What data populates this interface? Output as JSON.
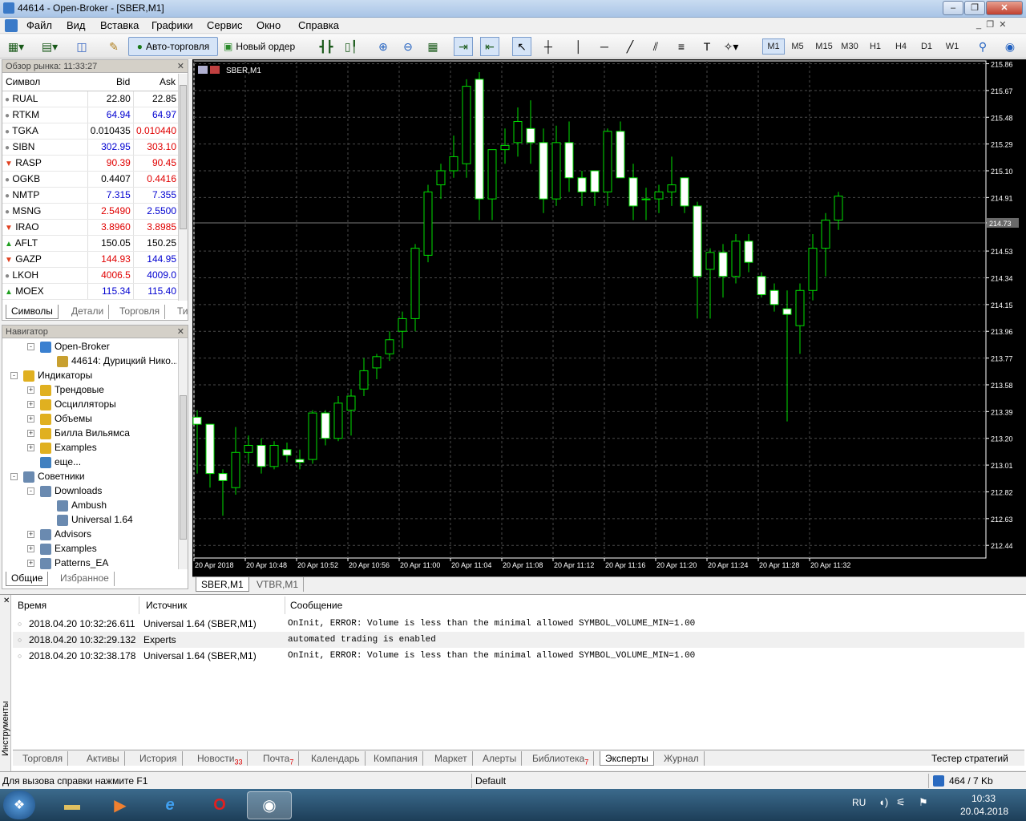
{
  "window": {
    "title": "44614 - Open-Broker - [SBER,M1]"
  },
  "menu": [
    "Файл",
    "Вид",
    "Вставка",
    "Графики",
    "Сервис",
    "Окно",
    "Справка"
  ],
  "toolbar": {
    "autotrade_label": "Авто-торговля",
    "new_order_label": "Новый ордер",
    "timeframes": [
      "M1",
      "M5",
      "M15",
      "M30",
      "H1",
      "H4",
      "D1",
      "W1"
    ],
    "active_timeframe": "M1"
  },
  "market_watch": {
    "header": "Обзор рынка: 11:33:27",
    "columns": [
      "Символ",
      "Bid",
      "Ask"
    ],
    "rows": [
      {
        "symbol": "RUAL",
        "bid": "22.80",
        "ask": "22.85",
        "bid_color": "blk",
        "ask_color": "blk",
        "icon": "grey"
      },
      {
        "symbol": "RTKM",
        "bid": "64.94",
        "ask": "64.97",
        "bid_color": "blue",
        "ask_color": "blue",
        "icon": "grey"
      },
      {
        "symbol": "TGKA",
        "bid": "0.010435",
        "ask": "0.010440",
        "bid_color": "blk",
        "ask_color": "red",
        "icon": "grey"
      },
      {
        "symbol": "SIBN",
        "bid": "302.95",
        "ask": "303.10",
        "bid_color": "blue",
        "ask_color": "red",
        "icon": "grey"
      },
      {
        "symbol": "RASP",
        "bid": "90.39",
        "ask": "90.45",
        "bid_color": "red",
        "ask_color": "red",
        "icon": "down"
      },
      {
        "symbol": "OGKB",
        "bid": "0.4407",
        "ask": "0.4416",
        "bid_color": "blk",
        "ask_color": "red",
        "icon": "grey"
      },
      {
        "symbol": "NMTP",
        "bid": "7.315",
        "ask": "7.355",
        "bid_color": "blue",
        "ask_color": "blue",
        "icon": "grey"
      },
      {
        "symbol": "MSNG",
        "bid": "2.5490",
        "ask": "2.5500",
        "bid_color": "red",
        "ask_color": "blue",
        "icon": "grey"
      },
      {
        "symbol": "IRAO",
        "bid": "3.8960",
        "ask": "3.8985",
        "bid_color": "red",
        "ask_color": "red",
        "icon": "down"
      },
      {
        "symbol": "AFLT",
        "bid": "150.05",
        "ask": "150.25",
        "bid_color": "blk",
        "ask_color": "blk",
        "icon": "up"
      },
      {
        "symbol": "GAZP",
        "bid": "144.93",
        "ask": "144.95",
        "bid_color": "red",
        "ask_color": "blue",
        "icon": "down"
      },
      {
        "symbol": "LKOH",
        "bid": "4006.5",
        "ask": "4009.0",
        "bid_color": "red",
        "ask_color": "blue",
        "icon": "grey"
      },
      {
        "symbol": "MOEX",
        "bid": "115.34",
        "ask": "115.40",
        "bid_color": "blue",
        "ask_color": "blue",
        "icon": "up"
      }
    ],
    "tabs": [
      "Символы",
      "Детали",
      "Торговля",
      "Ти"
    ]
  },
  "navigator": {
    "header": "Навигатор",
    "items": [
      {
        "label": "Open-Broker",
        "level": 2,
        "exp": "-",
        "icon": "broker"
      },
      {
        "label": "44614: Дурицкий Нико...",
        "level": 3,
        "exp": "",
        "icon": "account"
      },
      {
        "label": "Индикаторы",
        "level": 1,
        "exp": "-",
        "icon": "f"
      },
      {
        "label": "Трендовые",
        "level": 2,
        "exp": "+",
        "icon": "f"
      },
      {
        "label": "Осцилляторы",
        "level": 2,
        "exp": "+",
        "icon": "f"
      },
      {
        "label": "Объемы",
        "level": 2,
        "exp": "+",
        "icon": "f"
      },
      {
        "label": "Билла Вильямса",
        "level": 2,
        "exp": "+",
        "icon": "f"
      },
      {
        "label": "Examples",
        "level": 2,
        "exp": "+",
        "icon": "f"
      },
      {
        "label": "еще...",
        "level": 2,
        "exp": "",
        "icon": "more"
      },
      {
        "label": "Советники",
        "level": 1,
        "exp": "-",
        "icon": "ea"
      },
      {
        "label": "Downloads",
        "level": 2,
        "exp": "-",
        "icon": "ea"
      },
      {
        "label": "Ambush",
        "level": 3,
        "exp": "",
        "icon": "ea"
      },
      {
        "label": "Universal 1.64",
        "level": 3,
        "exp": "",
        "icon": "ea"
      },
      {
        "label": "Advisors",
        "level": 2,
        "exp": "+",
        "icon": "ea"
      },
      {
        "label": "Examples",
        "level": 2,
        "exp": "+",
        "icon": "ea"
      },
      {
        "label": "Patterns_EA",
        "level": 2,
        "exp": "+",
        "icon": "ea"
      }
    ],
    "tabs": [
      "Общие",
      "Избранное"
    ]
  },
  "chart_data": {
    "type": "candlestick",
    "title": "SBER,M1",
    "current_price": "214.73",
    "y_ticks": [
      "215.86",
      "215.67",
      "215.48",
      "215.29",
      "215.10",
      "214.91",
      "214.73",
      "214.53",
      "214.34",
      "214.15",
      "213.96",
      "213.77",
      "213.58",
      "213.39",
      "213.20",
      "213.01",
      "212.82",
      "212.63",
      "212.44"
    ],
    "x_ticks": [
      "20 Apr 2018",
      "20 Apr 10:48",
      "20 Apr 10:52",
      "20 Apr 10:56",
      "20 Apr 11:00",
      "20 Apr 11:04",
      "20 Apr 11:08",
      "20 Apr 11:12",
      "20 Apr 11:16",
      "20 Apr 11:20",
      "20 Apr 11:24",
      "20 Apr 11:28",
      "20 Apr 11:32"
    ],
    "ylim": [
      212.35,
      215.88
    ],
    "candles": [
      [
        213.35,
        213.4,
        212.95,
        213.3
      ],
      [
        213.3,
        213.3,
        212.85,
        212.95
      ],
      [
        212.95,
        212.98,
        212.65,
        212.9
      ],
      [
        212.85,
        213.28,
        212.8,
        213.1
      ],
      [
        213.1,
        213.22,
        213.02,
        213.15
      ],
      [
        213.15,
        213.2,
        212.95,
        213.0
      ],
      [
        213.0,
        213.18,
        212.98,
        213.15
      ],
      [
        213.12,
        213.17,
        213.03,
        213.08
      ],
      [
        213.05,
        213.12,
        212.98,
        213.03
      ],
      [
        213.05,
        213.4,
        213.02,
        213.38
      ],
      [
        213.38,
        213.4,
        213.15,
        213.2
      ],
      [
        213.2,
        213.5,
        213.18,
        213.45
      ],
      [
        213.4,
        213.55,
        213.22,
        213.5
      ],
      [
        213.55,
        213.77,
        213.5,
        213.68
      ],
      [
        213.7,
        213.8,
        213.62,
        213.78
      ],
      [
        213.8,
        213.96,
        213.75,
        213.9
      ],
      [
        213.96,
        214.1,
        213.84,
        214.05
      ],
      [
        214.05,
        214.58,
        213.96,
        214.55
      ],
      [
        214.5,
        215.0,
        214.45,
        214.95
      ],
      [
        215.0,
        215.15,
        214.9,
        215.1
      ],
      [
        215.1,
        215.35,
        215.05,
        215.2
      ],
      [
        215.15,
        215.75,
        215.05,
        215.7
      ],
      [
        215.75,
        215.8,
        214.75,
        214.9
      ],
      [
        214.9,
        215.25,
        214.75,
        215.25
      ],
      [
        215.25,
        215.4,
        215.15,
        215.28
      ],
      [
        215.3,
        215.55,
        215.2,
        215.45
      ],
      [
        215.4,
        215.6,
        215.15,
        215.3
      ],
      [
        215.3,
        215.4,
        214.8,
        214.9
      ],
      [
        214.9,
        215.42,
        214.85,
        215.3
      ],
      [
        215.3,
        215.45,
        214.95,
        215.05
      ],
      [
        215.05,
        215.1,
        214.85,
        214.95
      ],
      [
        215.1,
        215.1,
        214.85,
        214.95
      ],
      [
        214.95,
        215.4,
        214.85,
        215.38
      ],
      [
        215.38,
        215.45,
        215.05,
        215.05
      ],
      [
        215.05,
        215.15,
        214.75,
        214.85
      ],
      [
        214.9,
        214.98,
        214.75,
        214.9
      ],
      [
        214.9,
        215.0,
        214.8,
        214.95
      ],
      [
        214.95,
        215.2,
        214.85,
        215.0
      ],
      [
        215.05,
        215.05,
        214.8,
        214.85
      ],
      [
        214.85,
        214.88,
        214.05,
        214.35
      ],
      [
        214.4,
        214.55,
        214.05,
        214.52
      ],
      [
        214.52,
        214.58,
        214.2,
        214.35
      ],
      [
        214.35,
        214.65,
        214.3,
        214.6
      ],
      [
        214.6,
        214.65,
        214.38,
        214.45
      ],
      [
        214.35,
        214.38,
        214.2,
        214.22
      ],
      [
        214.25,
        214.3,
        214.1,
        214.15
      ],
      [
        214.12,
        214.25,
        213.32,
        214.08
      ],
      [
        214.0,
        214.3,
        213.8,
        214.25
      ],
      [
        214.25,
        214.65,
        214.18,
        214.55
      ],
      [
        214.55,
        214.8,
        214.35,
        214.75
      ],
      [
        214.75,
        214.95,
        214.68,
        214.92
      ]
    ]
  },
  "chart_tabs": [
    "SBER,M1",
    "VTBR,M1"
  ],
  "terminal": {
    "columns": [
      "Время",
      "Источник",
      "Сообщение"
    ],
    "rows": [
      {
        "time": "2018.04.20 10:32:26.611",
        "source": "Universal 1.64 (SBER,M1)",
        "message": "OnInit, ERROR: Volume is less than the minimal allowed SYMBOL_VOLUME_MIN=1.00"
      },
      {
        "time": "2018.04.20 10:32:29.132",
        "source": "Experts",
        "message": "automated trading is enabled"
      },
      {
        "time": "2018.04.20 10:32:38.178",
        "source": "Universal 1.64 (SBER,M1)",
        "message": "OnInit, ERROR: Volume is less than the minimal allowed SYMBOL_VOLUME_MIN=1.00"
      }
    ],
    "side_label": "Инструменты",
    "tabs": [
      {
        "label": "Торговля",
        "badge": ""
      },
      {
        "label": "Активы",
        "badge": ""
      },
      {
        "label": "История",
        "badge": ""
      },
      {
        "label": "Новости",
        "badge": "33"
      },
      {
        "label": "Почта",
        "badge": "7"
      },
      {
        "label": "Календарь",
        "badge": ""
      },
      {
        "label": "Компания",
        "badge": ""
      },
      {
        "label": "Маркет",
        "badge": ""
      },
      {
        "label": "Алерты",
        "badge": ""
      },
      {
        "label": "Библиотека",
        "badge": "7"
      },
      {
        "label": "Эксперты",
        "badge": ""
      },
      {
        "label": "Журнал",
        "badge": ""
      }
    ],
    "active_tab": "Эксперты",
    "tester_label": "Тестер стратегий"
  },
  "status": {
    "help": "Для вызова справки нажмите F1",
    "profile": "Default",
    "traffic": "464 / 7 Kb"
  },
  "taskbar": {
    "lang": "RU",
    "time": "10:33",
    "date": "20.04.2018"
  }
}
